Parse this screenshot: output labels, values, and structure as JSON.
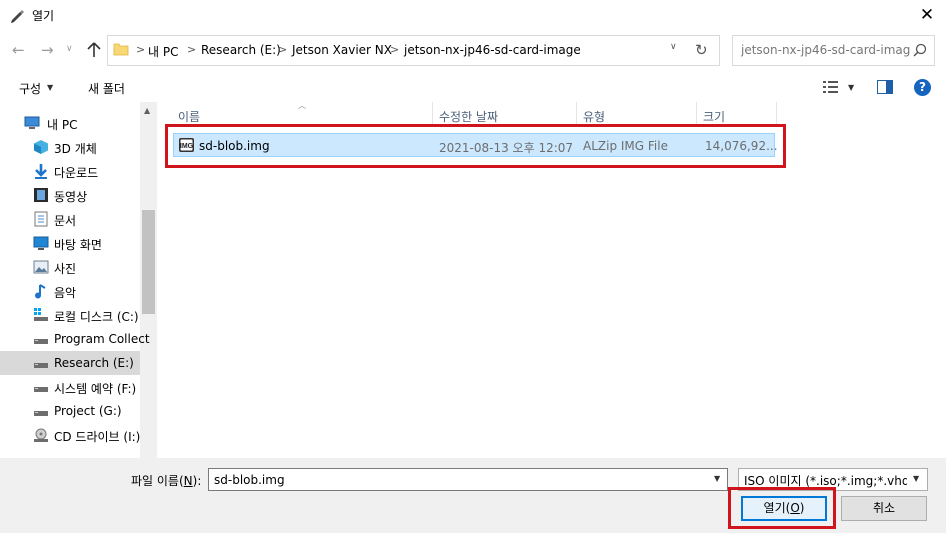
{
  "window": {
    "title": "열기",
    "close_label": "✕"
  },
  "nav": {
    "back": "←",
    "forward": "→",
    "history": "∨",
    "up": "↑",
    "breadcrumb": [
      "내 PC",
      "Research (E:)",
      "Jetson Xavier NX",
      "jetson-nx-jp46-sd-card-image"
    ],
    "crumb_separator": ">",
    "search_placeholder": "jetson-nx-jp46-sd-card-imag..."
  },
  "toolbar": {
    "organize": "구성",
    "new_folder": "새 폴더",
    "help": "?"
  },
  "sidebar": {
    "items": [
      {
        "label": "내 PC",
        "icon": "pc-icon"
      },
      {
        "label": "3D 개체",
        "icon": "3d-objects-icon"
      },
      {
        "label": "다운로드",
        "icon": "download-icon"
      },
      {
        "label": "동영상",
        "icon": "video-icon"
      },
      {
        "label": "문서",
        "icon": "document-icon"
      },
      {
        "label": "바탕 화면",
        "icon": "desktop-icon"
      },
      {
        "label": "사진",
        "icon": "picture-icon"
      },
      {
        "label": "음악",
        "icon": "music-icon"
      },
      {
        "label": "로컬 디스크 (C:)",
        "icon": "local-disk-icon"
      },
      {
        "label": "Program Collect",
        "icon": "drive-icon"
      },
      {
        "label": "Research (E:)",
        "icon": "drive-icon",
        "selected": true
      },
      {
        "label": "시스템 예약 (F:)",
        "icon": "drive-icon"
      },
      {
        "label": "Project (G:)",
        "icon": "drive-icon"
      },
      {
        "label": "CD 드라이브 (I:)",
        "icon": "cd-drive-icon"
      }
    ]
  },
  "filelist": {
    "columns": [
      "이름",
      "수정한 날짜",
      "유형",
      "크기"
    ],
    "rows": [
      {
        "name": "sd-blob.img",
        "modified": "2021-08-13 오후 12:07",
        "type": "ALZip IMG File",
        "size": "14,076,92..."
      }
    ]
  },
  "footer": {
    "filename_label": "파일 이름(N):",
    "filename_label_pre": "파일 이름(",
    "filename_label_key": "N",
    "filename_label_post": "):",
    "filename_value": "sd-blob.img",
    "filter_value": "ISO 이미지 (*.iso;*.img;*.vhd;*.",
    "open_pre": "열기(",
    "open_key": "O",
    "open_post": ")",
    "cancel": "취소"
  },
  "colors": {
    "selection_bg": "#cce8ff",
    "highlight_box": "#d0141e",
    "accent": "#0078d7"
  }
}
